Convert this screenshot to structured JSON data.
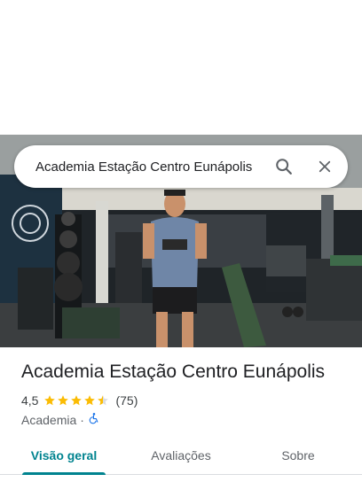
{
  "search": {
    "query": "Academia Estação Centro Eunápolis"
  },
  "place": {
    "name": "Academia Estação Centro Eunápolis",
    "rating": "4,5",
    "rating_value": 4.5,
    "review_count": "(75)",
    "category": "Academia",
    "separator": "·",
    "accessibility_icon": "wheelchair-icon"
  },
  "tabs": [
    {
      "label": "Visão geral",
      "active": true
    },
    {
      "label": "Avaliações",
      "active": false
    },
    {
      "label": "Sobre",
      "active": false
    }
  ],
  "colors": {
    "accent": "#00838f",
    "star": "#fbbc04",
    "star_empty": "#dadce0",
    "accessibility": "#1a73e8"
  }
}
